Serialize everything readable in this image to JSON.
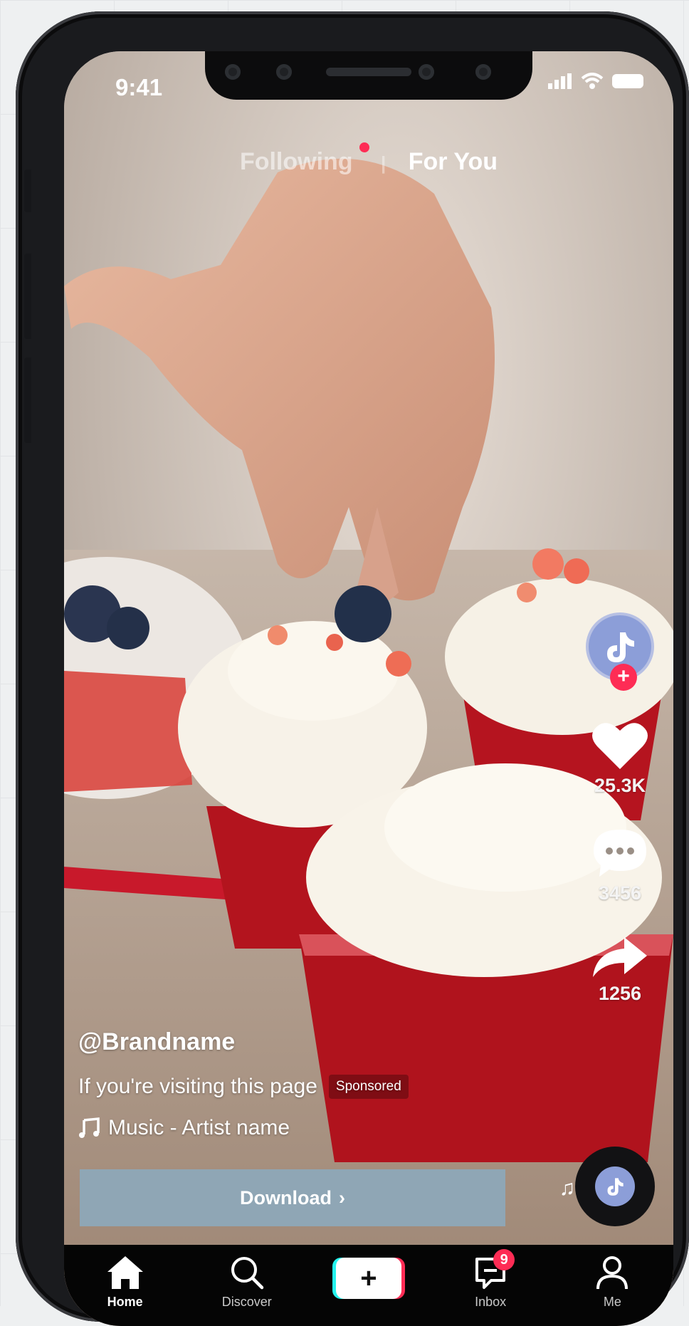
{
  "status_bar": {
    "time": "9:41"
  },
  "feed_tabs": {
    "following": "Following",
    "for_you": "For You"
  },
  "rail": {
    "likes": "25.3K",
    "comments": "3456",
    "shares": "1256"
  },
  "post": {
    "username": "@Brandname",
    "description": "If you're visiting this page",
    "sponsored": "Sponsored",
    "music": "Music - Artist name"
  },
  "cta": {
    "download_label": "Download",
    "arrow": "›"
  },
  "bottom_nav": {
    "home": "Home",
    "discover": "Discover",
    "inbox": "Inbox",
    "inbox_badge": "9",
    "me": "Me"
  },
  "colors": {
    "accent": "#fe2c55",
    "cyan": "#25f4ee",
    "cta_bg": "#8fa6b5",
    "avatar": "#8c9ed8"
  },
  "icons": [
    "home-icon",
    "search-icon",
    "plus-icon",
    "inbox-icon",
    "profile-icon",
    "heart-icon",
    "comment-icon",
    "share-icon",
    "music-note-icon",
    "tiktok-logo-icon"
  ]
}
